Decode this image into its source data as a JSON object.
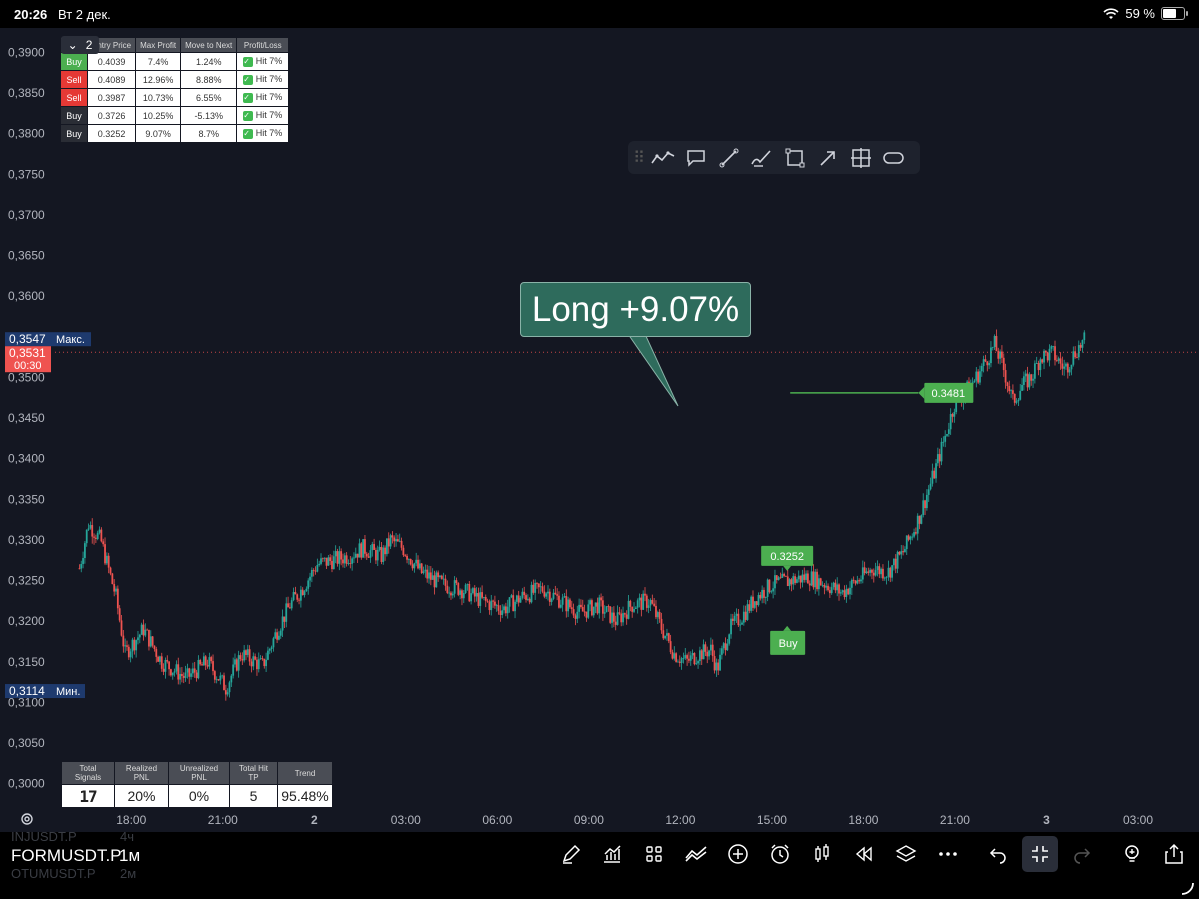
{
  "status": {
    "time": "20:26",
    "date": "Вт 2 дек.",
    "battery": "59 %",
    "battery_level": 0.59
  },
  "chart_data": {
    "type": "candlestick",
    "symbol": "FORMUSDT.P",
    "timeframe": "1м",
    "ylim": [
      0.2975,
      0.393
    ],
    "y_ticks": [
      "0,3900",
      "0,3850",
      "0,3800",
      "0,3750",
      "0,3700",
      "0,3650",
      "0,3600",
      "0,3500",
      "0,3450",
      "0,3400",
      "0,3350",
      "0,3300",
      "0,3250",
      "0,3200",
      "0,3150",
      "0,3100",
      "0,3050",
      "0,3000"
    ],
    "x_ticks": [
      "18:00",
      "21:00",
      "2",
      "03:00",
      "06:00",
      "09:00",
      "12:00",
      "15:00",
      "18:00",
      "21:00",
      "3",
      "03:00"
    ],
    "x_tick_hours": [
      18,
      21,
      24,
      27,
      30,
      33,
      36,
      39,
      42,
      45,
      48,
      51
    ],
    "x_tick_bold": [
      false,
      false,
      true,
      false,
      false,
      false,
      false,
      false,
      false,
      false,
      true,
      false
    ],
    "x_range_hours": [
      15.5,
      53
    ],
    "price_path": [
      [
        16.3,
        0.3265
      ],
      [
        16.6,
        0.332
      ],
      [
        17.0,
        0.33
      ],
      [
        17.5,
        0.323
      ],
      [
        17.8,
        0.316
      ],
      [
        18.4,
        0.319
      ],
      [
        19.0,
        0.315
      ],
      [
        19.8,
        0.313
      ],
      [
        20.5,
        0.315
      ],
      [
        21.1,
        0.3118
      ],
      [
        21.6,
        0.316
      ],
      [
        22.3,
        0.3145
      ],
      [
        22.8,
        0.319
      ],
      [
        23.2,
        0.322
      ],
      [
        23.6,
        0.324
      ],
      [
        24.1,
        0.327
      ],
      [
        24.6,
        0.3275
      ],
      [
        25.1,
        0.328
      ],
      [
        25.6,
        0.329
      ],
      [
        26.2,
        0.328
      ],
      [
        26.5,
        0.33
      ],
      [
        26.9,
        0.329
      ],
      [
        27.5,
        0.326
      ],
      [
        28.2,
        0.3245
      ],
      [
        28.8,
        0.324
      ],
      [
        29.5,
        0.3225
      ],
      [
        30.2,
        0.3215
      ],
      [
        30.8,
        0.323
      ],
      [
        31.5,
        0.324
      ],
      [
        32.1,
        0.3225
      ],
      [
        32.7,
        0.321
      ],
      [
        33.3,
        0.322
      ],
      [
        33.9,
        0.32
      ],
      [
        34.4,
        0.322
      ],
      [
        35.0,
        0.3225
      ],
      [
        35.4,
        0.319
      ],
      [
        35.8,
        0.316
      ],
      [
        36.2,
        0.315
      ],
      [
        36.6,
        0.316
      ],
      [
        37.0,
        0.3165
      ],
      [
        37.2,
        0.314
      ],
      [
        37.6,
        0.319
      ],
      [
        38.1,
        0.321
      ],
      [
        38.5,
        0.323
      ],
      [
        39.0,
        0.3245
      ],
      [
        39.6,
        0.325
      ],
      [
        40.2,
        0.3255
      ],
      [
        40.8,
        0.3245
      ],
      [
        41.3,
        0.3235
      ],
      [
        41.8,
        0.325
      ],
      [
        42.3,
        0.3265
      ],
      [
        42.8,
        0.326
      ],
      [
        43.3,
        0.3285
      ],
      [
        43.8,
        0.3325
      ],
      [
        44.3,
        0.338
      ],
      [
        44.7,
        0.343
      ],
      [
        45.0,
        0.347
      ],
      [
        45.3,
        0.348
      ],
      [
        45.7,
        0.35
      ],
      [
        46.0,
        0.352
      ],
      [
        46.3,
        0.354
      ],
      [
        46.6,
        0.351
      ],
      [
        46.9,
        0.347
      ],
      [
        47.2,
        0.349
      ],
      [
        47.5,
        0.35
      ],
      [
        47.8,
        0.3525
      ],
      [
        48.2,
        0.353
      ],
      [
        48.6,
        0.351
      ],
      [
        49.0,
        0.3535
      ],
      [
        49.3,
        0.3547
      ]
    ],
    "current_price": "0,3531",
    "countdown": "00:30",
    "max_label": "Макс.",
    "max_value": "0,3547",
    "min_label": "Мин.",
    "min_value": "0,3114",
    "entry_price_label": "0.3252",
    "entry_marker_label": "Buy",
    "entry_time_hours": 39.5,
    "entry_price": 0.3252,
    "target_label": "0.3481",
    "target_price": 0.3481,
    "target_line_hours": [
      39.6,
      43.8
    ],
    "colors": {
      "up": "#26a69a",
      "down": "#ef5350",
      "signal": "#4caf50",
      "current": "#ef5350",
      "minmax": "#2962ff"
    }
  },
  "callout": {
    "text": "Long +9.07%"
  },
  "signals_table": {
    "collapse_count": "2",
    "headers": [
      "Entry Price",
      "Max Profit",
      "Move to Next",
      "Profit/Loss"
    ],
    "rows": [
      {
        "side": "Buy",
        "side_class": "buy",
        "entry": "0.4039",
        "max": "7.4%",
        "move": "1.24%",
        "pl": "Hit 7%"
      },
      {
        "side": "Sell",
        "side_class": "sell",
        "entry": "0.4089",
        "max": "12.96%",
        "move": "8.88%",
        "pl": "Hit 7%"
      },
      {
        "side": "Sell",
        "side_class": "sell",
        "entry": "0.3987",
        "max": "10.73%",
        "move": "6.55%",
        "pl": "Hit 7%"
      },
      {
        "side": "Buy",
        "side_class": "buy2",
        "entry": "0.3726",
        "max": "10.25%",
        "move": "-5.13%",
        "pl": "Hit 7%"
      },
      {
        "side": "Buy",
        "side_class": "buy2",
        "entry": "0.3252",
        "max": "9.07%",
        "move": "8.7%",
        "pl": "Hit 7%"
      }
    ]
  },
  "stats_table": {
    "headers": [
      "Total Signals",
      "Realized PNL",
      "Unrealized PNL",
      "Total Hit TP",
      "Trend"
    ],
    "values": [
      "17",
      "20%",
      "0%",
      "5",
      "95.48%"
    ]
  },
  "drawing_toolbar": {
    "tools": [
      "trend-line-icon",
      "callout-icon",
      "line-icon",
      "brush-icon",
      "rectangle-icon",
      "arrow-icon",
      "crosshair-box-icon",
      "ellipse-shape-icon"
    ]
  },
  "bottom": {
    "prev_symbol": "INJUSDT.P",
    "prev_tf": "4ч",
    "symbol": "FORMUSDT.P",
    "timeframe": "1м",
    "next_symbol": "OTUMUSDT.P",
    "next_tf": "2м",
    "tools": [
      "pencil-icon",
      "indicators-icon",
      "layout-grid-icon",
      "compare-icon",
      "add-icon",
      "alert-clock-icon",
      "candles-icon",
      "replay-icon",
      "layers-icon",
      "more-icon",
      "undo-icon",
      "fullscreen-exit-icon",
      "redo-icon",
      "bulb-icon",
      "share-icon"
    ]
  }
}
